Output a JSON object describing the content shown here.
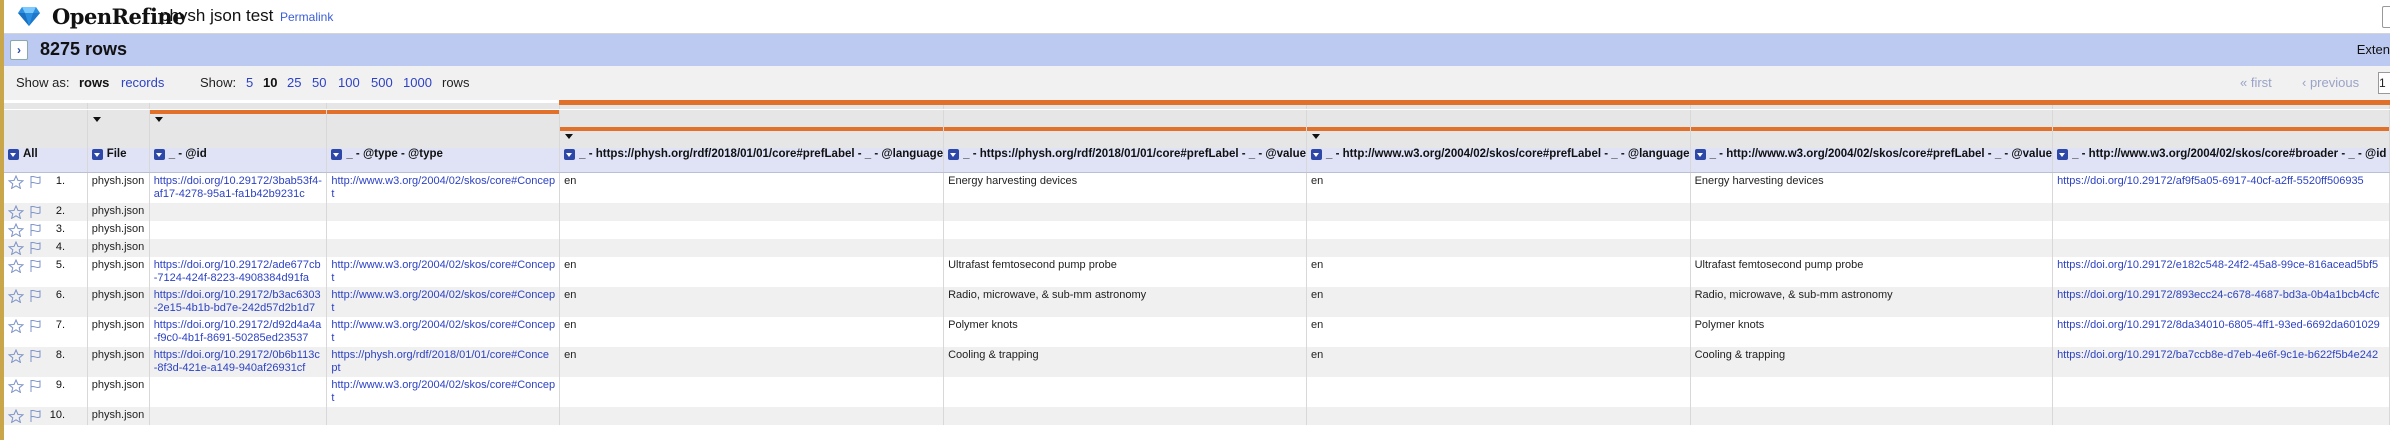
{
  "app": {
    "name": "OpenRefine",
    "project": "physh json test",
    "permalink": "Permalink"
  },
  "summary": {
    "row_count": "8275 rows",
    "extensions_label": "Exten"
  },
  "controls": {
    "show_as_label": "Show as:",
    "show_as_rows": "rows",
    "show_as_records": "records",
    "show_label": "Show:",
    "page_sizes": [
      "5",
      "10",
      "25",
      "50",
      "100",
      "500",
      "1000"
    ],
    "page_sizes_suffix": "rows",
    "first": "« first",
    "previous": "‹ previous",
    "page_input": "1"
  },
  "columns": {
    "all": "All",
    "file": "File",
    "c1": "_ - @id",
    "c2": "_ - @type - @type",
    "c3": "_ - https://physh.org/rdf/2018/01/01/core#prefLabel - _ - @language",
    "c4": "_ - https://physh.org/rdf/2018/01/01/core#prefLabel - _ - @value",
    "c5": "_ - http://www.w3.org/2004/02/skos/core#prefLabel - _ - @language",
    "c6": "_ - http://www.w3.org/2004/02/skos/core#prefLabel - _ - @value",
    "c7": "_ - http://www.w3.org/2004/02/skos/core#broader - _ - @id"
  },
  "rows": [
    {
      "n": "1.",
      "file": "physh.json",
      "id": "https://doi.org/10.29172/3bab53f4-af17-4278-95a1-fa1b42b9231c",
      "type": "http://www.w3.org/2004/02/skos/core#Concept",
      "lang1": "en",
      "val1": "Energy harvesting devices",
      "lang2": "en",
      "val2": "Energy harvesting devices",
      "broader": "https://doi.org/10.29172/af9f5a05-6917-40cf-a2ff-5520ff506935"
    },
    {
      "n": "2.",
      "file": "physh.json",
      "id": "",
      "type": "",
      "lang1": "",
      "val1": "",
      "lang2": "",
      "val2": "",
      "broader": ""
    },
    {
      "n": "3.",
      "file": "physh.json",
      "id": "",
      "type": "",
      "lang1": "",
      "val1": "",
      "lang2": "",
      "val2": "",
      "broader": ""
    },
    {
      "n": "4.",
      "file": "physh.json",
      "id": "",
      "type": "",
      "lang1": "",
      "val1": "",
      "lang2": "",
      "val2": "",
      "broader": ""
    },
    {
      "n": "5.",
      "file": "physh.json",
      "id": "https://doi.org/10.29172/ade677cb-7124-424f-8223-4908384d91fa",
      "type": "http://www.w3.org/2004/02/skos/core#Concept",
      "lang1": "en",
      "val1": "Ultrafast femtosecond pump probe",
      "lang2": "en",
      "val2": "Ultrafast femtosecond pump probe",
      "broader": "https://doi.org/10.29172/e182c548-24f2-45a8-99ce-816acead5bf5"
    },
    {
      "n": "6.",
      "file": "physh.json",
      "id": "https://doi.org/10.29172/b3ac6303-2e15-4b1b-bd7e-242d57d2b1d7",
      "type": "http://www.w3.org/2004/02/skos/core#Concept",
      "lang1": "en",
      "val1": "Radio, microwave, & sub-mm astronomy",
      "lang2": "en",
      "val2": "Radio, microwave, & sub-mm astronomy",
      "broader": "https://doi.org/10.29172/893ecc24-c678-4687-bd3a-0b4a1bcb4cfc"
    },
    {
      "n": "7.",
      "file": "physh.json",
      "id": "https://doi.org/10.29172/d92d4a4a-f9c0-4b1f-8691-50285ed23537",
      "type": "http://www.w3.org/2004/02/skos/core#Concept",
      "lang1": "en",
      "val1": "Polymer knots",
      "lang2": "en",
      "val2": "Polymer knots",
      "broader": "https://doi.org/10.29172/8da34010-6805-4ff1-93ed-6692da601029"
    },
    {
      "n": "8.",
      "file": "physh.json",
      "id": "https://doi.org/10.29172/0b6b113c-8f3d-421e-a149-940af26931cf",
      "type": "https://physh.org/rdf/2018/01/01/core#Concept",
      "lang1": "en",
      "val1": "Cooling & trapping",
      "lang2": "en",
      "val2": "Cooling & trapping",
      "broader": "https://doi.org/10.29172/ba7ccb8e-d7eb-4e6f-9c1e-b622f5b4e242"
    },
    {
      "n": "9.",
      "file": "physh.json",
      "id": "",
      "type": "http://www.w3.org/2004/02/skos/core#Concept",
      "lang1": "",
      "val1": "",
      "lang2": "",
      "val2": "",
      "broader": ""
    },
    {
      "n": "10.",
      "file": "physh.json",
      "id": "",
      "type": "",
      "lang1": "",
      "val1": "",
      "lang2": "",
      "val2": "",
      "broader": ""
    }
  ]
}
